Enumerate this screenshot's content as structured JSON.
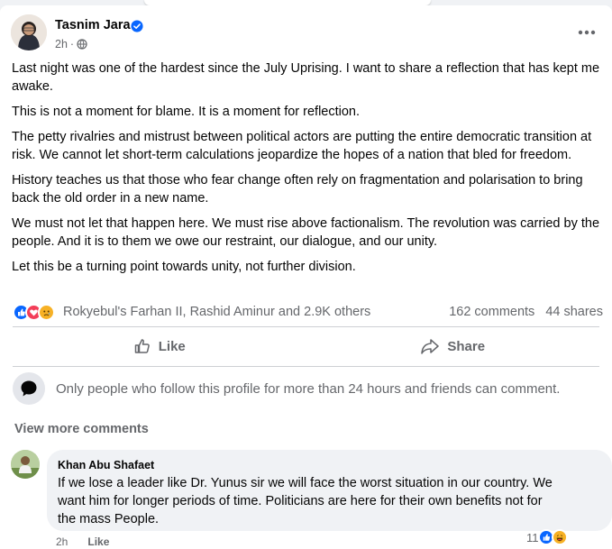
{
  "post": {
    "author": "Tasnim Jara",
    "time": "2h",
    "paragraphs": [
      "Last night was one of the hardest since the July Uprising. I want to share a reflection that has kept me awake.",
      "This is not a moment for blame. It is a moment for reflection.",
      "The petty rivalries and mistrust between political actors are putting the entire democratic transition at risk. We cannot let short-term calculations jeopardize the hopes of a nation that bled for freedom.",
      "History teaches us that those who fear change often rely on fragmentation and polarisation to bring back the old order in a new name.",
      "We must not let that happen here. We must rise above factionalism. The revolution was carried by the people. And it is to them we owe our restraint, our dialogue, and our unity.",
      "Let this be a turning point towards unity, not further division."
    ],
    "reactions_text": "Rokyebul's Farhan II, Rashid Aminur and 2.9K others",
    "comments_count": "162 comments",
    "shares_count": "44 shares",
    "reaction_icons": [
      "like-icon",
      "love-icon",
      "sad-icon"
    ]
  },
  "actions": {
    "like_label": "Like",
    "share_label": "Share"
  },
  "restriction_notice": "Only people who follow this profile for more than 24 hours and friends can comment.",
  "view_more_label": "View more comments",
  "comment": {
    "author": "Khan Abu Shafaet",
    "text": "If we lose a leader like Dr. Yunus sir we will face the worst situation in our country. We want him for longer periods of time. Politicians are here for their own benefits not for the mass People.",
    "time": "2h",
    "like_label": "Like",
    "reaction_count": "11"
  },
  "colors": {
    "accent_blue": "#0866ff",
    "love_red": "#f33e58",
    "sad_yellow": "#f7b125",
    "muted_text": "#65676b"
  }
}
